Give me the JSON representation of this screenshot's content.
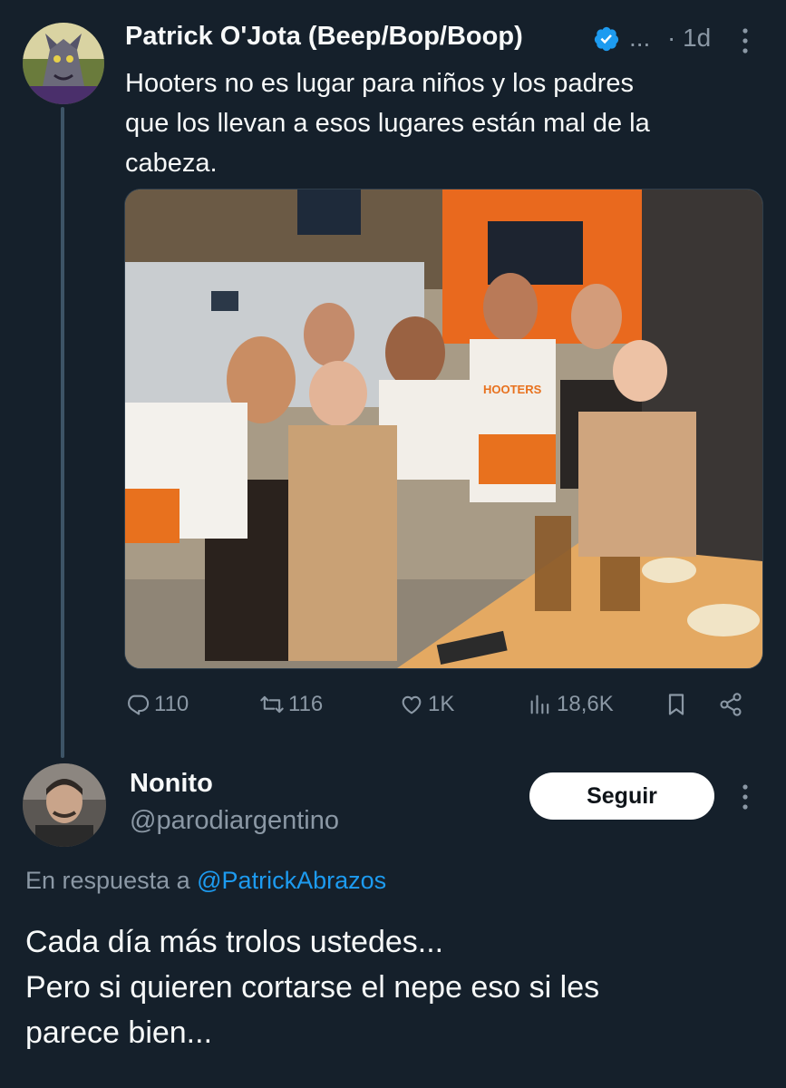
{
  "tweet": {
    "author_name": "Patrick O'Jota (Beep/Bop/Boop)",
    "ellipsis": "...",
    "time": "· 1d",
    "lines": [
      "Hooters no es lugar para niños y los padres",
      "que los llevan a esos lugares están mal de la",
      "cabeza."
    ],
    "actions": {
      "reply_count": "110",
      "retweet_count": "116",
      "like_count": "1K",
      "views_count": "18,6K"
    },
    "photo_sign": "HOOTERS"
  },
  "reply": {
    "author_name": "Nonito",
    "handle": "@parodiargentino",
    "follow_label": "Seguir",
    "replying_prefix": "En respuesta a",
    "replying_mention": "@PatrickAbrazos",
    "lines": [
      "Cada día más trolos ustedes...",
      "Pero si quieren cortarse el nepe eso si les",
      "parece bien..."
    ]
  },
  "colors": {
    "background": "#15202b",
    "text_primary": "#f7f9f9",
    "text_secondary": "#8b98a5",
    "accent": "#1d9bf0",
    "thread_line": "#3d5466"
  },
  "icons": [
    "verified-badge-icon",
    "more-icon",
    "reply-icon",
    "retweet-icon",
    "like-icon",
    "views-icon",
    "bookmark-icon",
    "share-icon"
  ]
}
